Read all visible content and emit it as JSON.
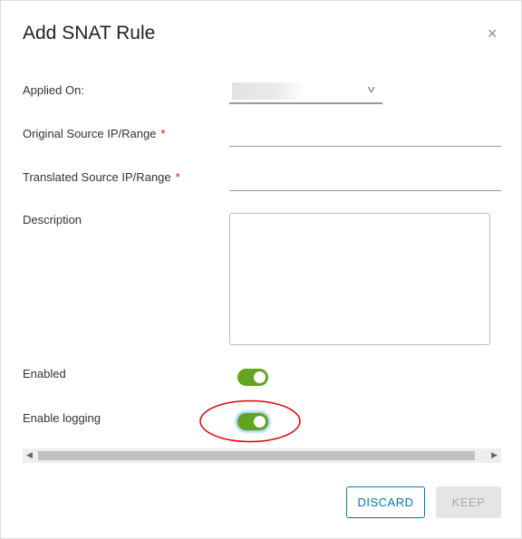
{
  "dialog": {
    "title": "Add SNAT Rule",
    "close_icon": "×"
  },
  "fields": {
    "applied_on": {
      "label": "Applied On:"
    },
    "original_source": {
      "label": "Original Source IP/Range",
      "required": "*"
    },
    "translated_source": {
      "label": "Translated Source IP/Range",
      "required": "*"
    },
    "description": {
      "label": "Description"
    },
    "enabled": {
      "label": "Enabled",
      "value": true
    },
    "enable_logging": {
      "label": "Enable logging",
      "value": true
    }
  },
  "buttons": {
    "discard": "DISCARD",
    "keep": "KEEP"
  },
  "colors": {
    "toggle_on": "#62a420",
    "primary": "#0079b8",
    "annotation": "#e00000"
  }
}
